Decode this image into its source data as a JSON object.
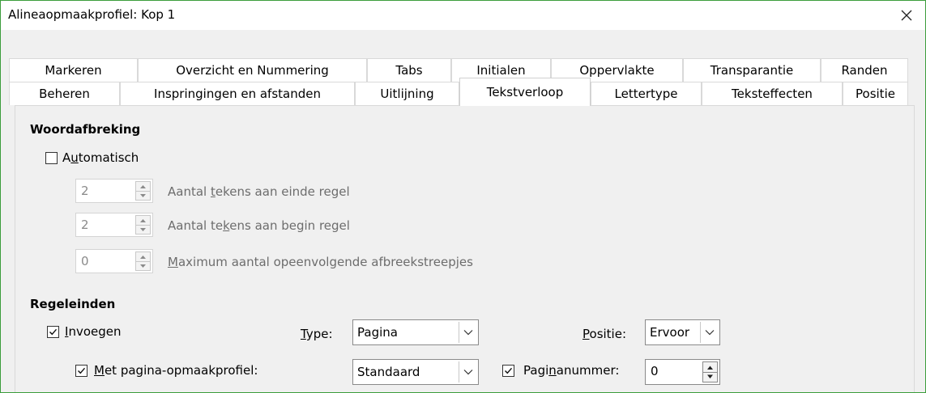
{
  "window": {
    "title": "Alineaopmaakprofiel: Kop 1",
    "close_glyph": "✕"
  },
  "tabs": {
    "row1": [
      "Markeren",
      "Overzicht en Nummering",
      "Tabs",
      "Initialen",
      "Oppervlakte",
      "Transparantie",
      "Randen"
    ],
    "row2": [
      "Beheren",
      "Inspringingen en afstanden",
      "Uitlijning",
      "Tekstverloop",
      "Lettertype",
      "Teksteffecten",
      "Positie"
    ],
    "active": "Tekstverloop"
  },
  "hyphenation": {
    "title": "Woordafbreking",
    "auto_checked": false,
    "auto": {
      "before": "A",
      "key": "u",
      "after": "tomatisch"
    },
    "fields": [
      {
        "value": "2",
        "label_before": "Aantal ",
        "label_key": "t",
        "label_after": "ekens aan einde regel"
      },
      {
        "value": "2",
        "label_before": "Aantal te",
        "label_key": "k",
        "label_after": "ens aan begin regel"
      },
      {
        "value": "0",
        "label_before": "",
        "label_key": "M",
        "label_after": "aximum aantal opeenvolgende afbreekstreepjes"
      }
    ]
  },
  "breaks": {
    "title": "Regeleinden",
    "insert": {
      "checked": true,
      "key": "I",
      "after": "nvoegen"
    },
    "type": {
      "key": "T",
      "after": "ype:",
      "value": "Pagina"
    },
    "position": {
      "key": "P",
      "after": "ositie:",
      "value": "Ervoor"
    },
    "with_style": {
      "checked": true,
      "key": "M",
      "after": "et pagina-opmaakprofiel:",
      "value": "Standaard"
    },
    "page_number": {
      "checked": true,
      "before": "Pagi",
      "key": "n",
      "after": "anummer:",
      "value": "0"
    }
  }
}
